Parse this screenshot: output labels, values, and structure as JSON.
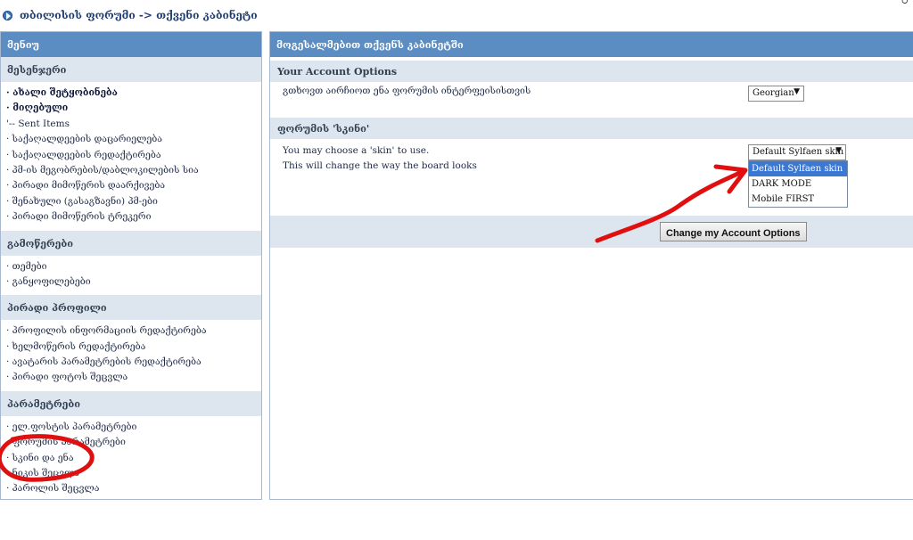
{
  "breadcrumb": {
    "text": "თბილისის ფორუმი -> თქვენი კაბინეტი"
  },
  "corner_mark": "ഠ",
  "sidebar": {
    "header": "მენიუ",
    "sections": [
      {
        "title": "მესენჯერი",
        "items": [
          {
            "label": "· ახალი შეტყობინება",
            "bold": true
          },
          {
            "label": "· მიღებული",
            "bold": true
          },
          {
            "label": "'-- Sent Items",
            "bold": false
          },
          {
            "label": "· საქაღალდეების დაცარიელება",
            "bold": false
          },
          {
            "label": "· საქაღალდეების რედაქტირება",
            "bold": false
          },
          {
            "label": "· პმ-ის მეგობრების/დაბლოკილების სია",
            "bold": false
          },
          {
            "label": "· პირადი მიმოწერის დაარქივება",
            "bold": false
          },
          {
            "label": "· შენახული (გასაგზავნი) პმ-ები",
            "bold": false
          },
          {
            "label": "· პირადი მიმოწერის ტრეკერი",
            "bold": false
          }
        ]
      },
      {
        "title": "გამოწერები",
        "items": [
          {
            "label": "· თემები",
            "bold": false
          },
          {
            "label": "· განყოფილებები",
            "bold": false
          }
        ]
      },
      {
        "title": "პირადი პროფილი",
        "items": [
          {
            "label": "· პროფილის ინფორმაციის რედაქტირება",
            "bold": false
          },
          {
            "label": "· ხელმოწერის რედაქტირება",
            "bold": false
          },
          {
            "label": "· ავატარის პარამეტრების რედაქტირება",
            "bold": false
          },
          {
            "label": "· პირადი ფოტოს შეცვლა",
            "bold": false
          }
        ]
      },
      {
        "title": "პარამეტრები",
        "items": [
          {
            "label": "· ელ.ფოსტის პარამეტრები",
            "bold": false
          },
          {
            "label": "· ფორუმის პარამეტრები",
            "bold": false
          },
          {
            "label": "· სკინი და ენა",
            "bold": false
          },
          {
            "label": "· ნიკის შეცვლა",
            "bold": false
          },
          {
            "label": "· პაროლის შეცვლა",
            "bold": false
          }
        ]
      }
    ]
  },
  "main": {
    "header": "მოგესალმებით თქვენს კაბინეტში",
    "account_options_title": "Your Account Options",
    "language_label": "გთხოვთ აირჩიოთ ენა ფორუმის ინტერფეისისთვის",
    "language_value": "Georgian",
    "skin_section_title": "ფორუმის 'სკინი'",
    "skin_label_line1": "You may choose a 'skin' to use.",
    "skin_label_line2": "This will change the way the board looks",
    "skin_value": "Default Sylfaen skin",
    "skin_options": [
      "Default Sylfaen skin",
      "DARK MODE",
      "Mobile FIRST"
    ],
    "skin_selected_index": 0,
    "submit_label": "Change my Account Options"
  },
  "colors": {
    "header_blue": "#5b8dc2",
    "section_gray": "#dde5ee",
    "selected_option": "#3b78d4",
    "annotation_red": "#e01010"
  }
}
